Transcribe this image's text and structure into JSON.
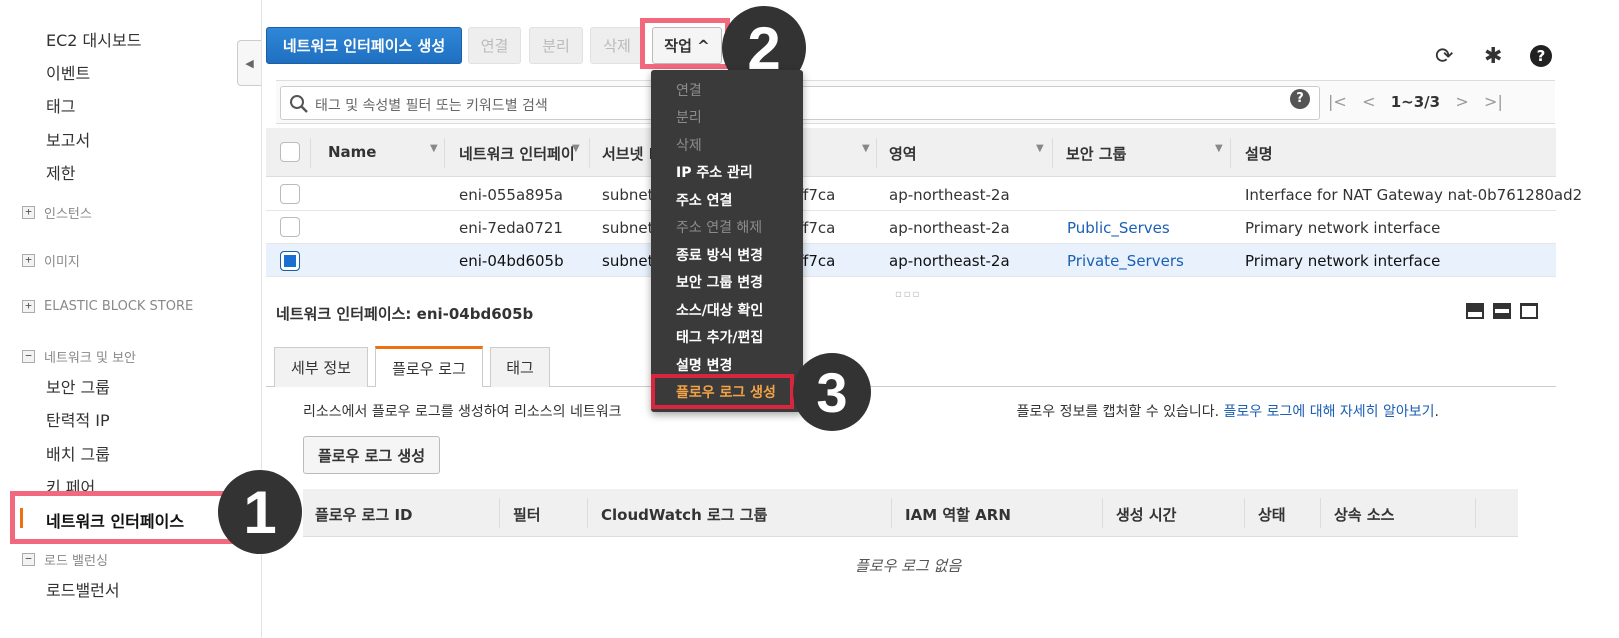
{
  "sidebar": {
    "items_top": [
      "EC2 대시보드",
      "이벤트",
      "태그",
      "보고서",
      "제한"
    ],
    "groups": {
      "instances": "인스턴스",
      "images": "이미지",
      "ebs": "ELASTIC BLOCK STORE",
      "network": "네트워크 및 보안",
      "lb": "로드 밸런싱"
    },
    "network_items": [
      "보안 그룹",
      "탄력적 IP",
      "배치 그룹",
      "키 페어",
      "네트워크 인터페이스"
    ],
    "lb_items": [
      "로드밸런서"
    ],
    "active": "네트워크 인터페이스"
  },
  "toolbar": {
    "create_label": "네트워크 인터페이스 생성",
    "attach_label": "연결",
    "detach_label": "분리",
    "delete_label": "삭제",
    "actions_label": "작업 ^"
  },
  "badges": [
    "1",
    "2",
    "3"
  ],
  "icons": {
    "refresh": "refresh-icon",
    "settings": "gear-icon",
    "help": "help-icon",
    "search": "search-icon"
  },
  "search": {
    "placeholder": "태그 및 속성별 필터 또는 키워드별 검색",
    "help": "?",
    "range": "1~3/3"
  },
  "table": {
    "columns": [
      "Name",
      "네트워크 인터페이",
      "서브넷 I",
      "영역",
      "보안 그룹",
      "설명"
    ],
    "rows": [
      {
        "eni": "eni-055a895a",
        "subnet": "subnet-",
        "vpc_tail": "ff7ca",
        "zone": "ap-northeast-2a",
        "sg": "",
        "desc": "Interface for NAT Gateway nat-0b761280ad2",
        "selected": false
      },
      {
        "eni": "eni-7eda0721",
        "subnet": "subnet-",
        "vpc_tail": "ff7ca",
        "zone": "ap-northeast-2a",
        "sg": "Public_Serves",
        "desc": "Primary network interface",
        "selected": false
      },
      {
        "eni": "eni-04bd605b",
        "subnet": "subnet-",
        "vpc_tail": "ff7ca",
        "zone": "ap-northeast-2a",
        "sg": "Private_Servers",
        "desc": "Primary network interface",
        "selected": true
      }
    ]
  },
  "detail": {
    "title": "네트워크 인터페이스: eni-04bd605b",
    "tabs": [
      "세부 정보",
      "플로우 로그",
      "태그"
    ],
    "info_prefix": "리소스에서 플로우 로그를 생성하여 리소스의 네트워크",
    "info_suffix": "플로우 정보를 캡처할 수 있습니다.",
    "info_link": "플로우 로그에 대해 자세히 알아보기",
    "info_period": ".",
    "create_flow_label": "플로우 로그 생성",
    "flow_columns": [
      "플로우 로그 ID",
      "필터",
      "CloudWatch 로그 그룹",
      "IAM 역할 ARN",
      "생성 시간",
      "상태",
      "상속 소스"
    ],
    "empty": "플로우 로그 없음"
  },
  "dropdown": {
    "items": [
      {
        "label": "연결",
        "enabled": false
      },
      {
        "label": "분리",
        "enabled": false
      },
      {
        "label": "삭제",
        "enabled": false
      },
      {
        "label": "IP 주소 관리",
        "enabled": true
      },
      {
        "label": "주소 연결",
        "enabled": true
      },
      {
        "label": "주소 연결 해제",
        "enabled": false
      },
      {
        "label": "종료 방식 변경",
        "enabled": true
      },
      {
        "label": "보안 그룹 변경",
        "enabled": true
      },
      {
        "label": "소스/대상 확인",
        "enabled": true
      },
      {
        "label": "태그 추가/편집",
        "enabled": true
      },
      {
        "label": "설명 변경",
        "enabled": true
      },
      {
        "label": "플로우 로그 생성",
        "enabled": true
      }
    ]
  },
  "colors": {
    "primary": "#1f6fc0",
    "highlight": "#f2697e",
    "menu_highlight": "#d7263d",
    "accent": "#ec7211",
    "link": "#1a5fb4"
  }
}
